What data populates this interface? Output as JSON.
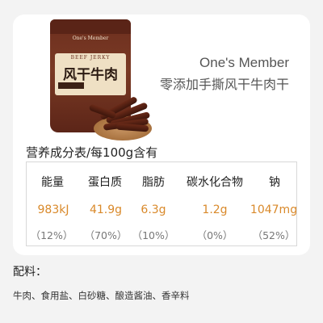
{
  "product": {
    "brand": "One's Member",
    "name_cn": "零添加手撕风干牛肉干",
    "bag_brand": "One's Member",
    "bag_en": "BEEF JERKY",
    "bag_cn": "风干牛肉"
  },
  "nutrition": {
    "title": "营养成分表/每100g含有",
    "headers": [
      "能量",
      "蛋白质",
      "脂肪",
      "碳水化合物",
      "钠"
    ],
    "values": [
      "983kJ",
      "41.9g",
      "6.3g",
      "1.2g",
      "1047mg"
    ],
    "percents": [
      "（12%）",
      "（70%）",
      "（10%）",
      "（0%）",
      "（52%）"
    ]
  },
  "ingredients": {
    "title": "配料：",
    "text": "牛肉、食用盐、白砂糖、酿造酱油、香辛料"
  },
  "colors": {
    "value_accent": "#d9892a",
    "background": "#f3f3f3",
    "card": "#ffffff"
  }
}
